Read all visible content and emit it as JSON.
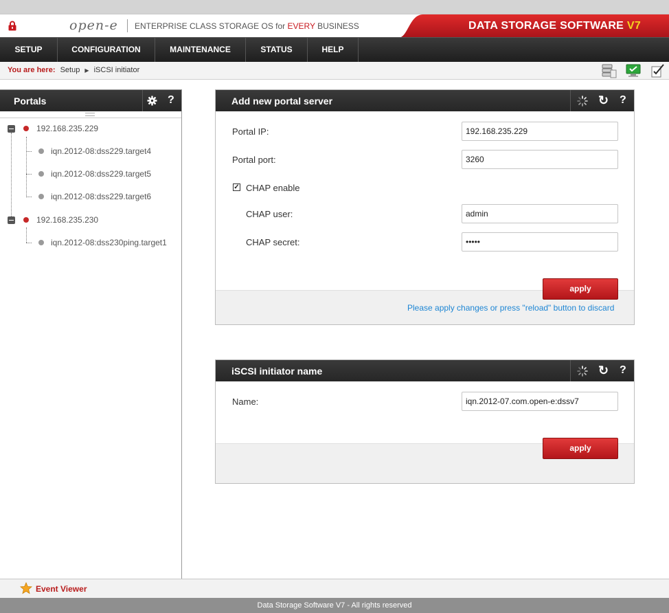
{
  "header": {
    "logo": "open-e",
    "tagline_pre": "ENTERPRISE CLASS STORAGE OS for ",
    "tagline_em": "EVERY",
    "tagline_post": " BUSINESS",
    "brand": "DATA STORAGE SOFTWARE ",
    "brand_version": "V7",
    "brand_color": "#c8181e"
  },
  "menu": [
    "SETUP",
    "CONFIGURATION",
    "MAINTENANCE",
    "STATUS",
    "HELP"
  ],
  "breadcrumb": {
    "label": "You are here:",
    "items": [
      "Setup",
      "iSCSI initiator"
    ]
  },
  "portals": {
    "title": "Portals",
    "tree": [
      {
        "ip": "192.168.235.229",
        "targets": [
          "iqn.2012-08:dss229.target4",
          "iqn.2012-08:dss229.target5",
          "iqn.2012-08:dss229.target6"
        ]
      },
      {
        "ip": "192.168.235.230",
        "targets": [
          "iqn.2012-08:dss230ping.target1"
        ]
      }
    ]
  },
  "add_portal": {
    "title": "Add new portal server",
    "portal_ip_label": "Portal IP:",
    "portal_ip": "192.168.235.229",
    "portal_port_label": "Portal port:",
    "portal_port": "3260",
    "chap_enable_label": "CHAP enable",
    "chap_checked": true,
    "chap_user_label": "CHAP user:",
    "chap_user": "admin",
    "chap_secret_label": "CHAP secret:",
    "chap_secret": "admin",
    "apply_label": "apply",
    "note": "Please apply changes or press \"reload\" button to discard"
  },
  "initiator": {
    "title": "iSCSI initiator name",
    "name_label": "Name:",
    "name": "iqn.2012-07.com.open-e:dssv7",
    "apply_label": "apply"
  },
  "event_viewer": "Event Viewer",
  "footer": "Data Storage Software V7 - All rights reserved",
  "icons": [
    "lock-icon",
    "gear-icon",
    "help-icon",
    "spinner-icon",
    "reload-icon",
    "star-icon",
    "storage-icon",
    "monitor-icon",
    "checklist-icon"
  ]
}
